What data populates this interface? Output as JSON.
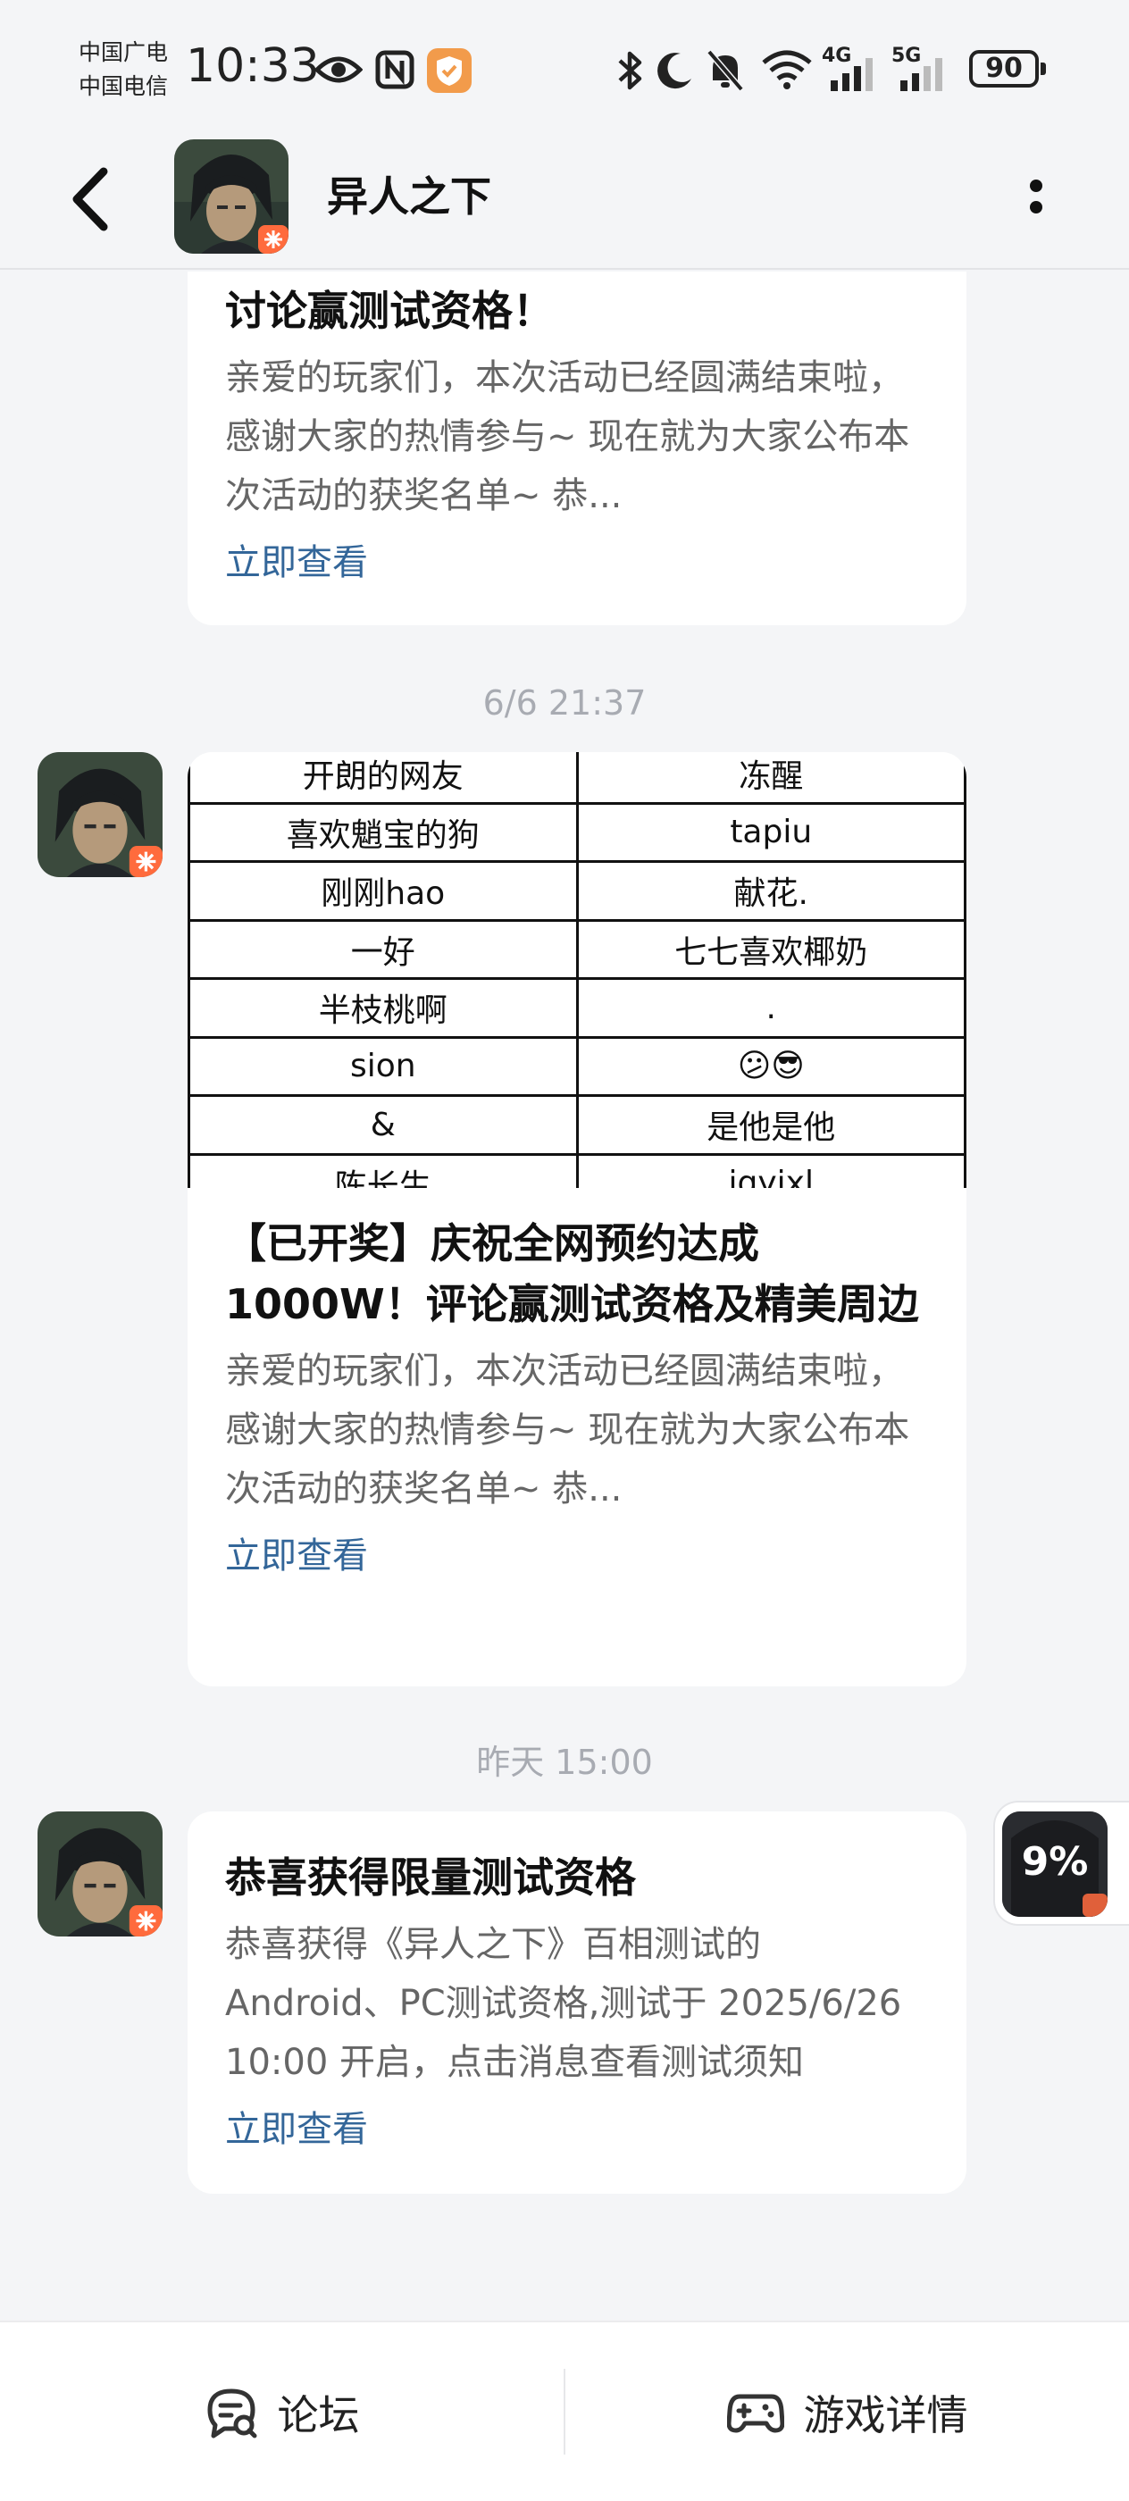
{
  "status_bar": {
    "carrier_1": "中国广电",
    "carrier_2": "中国电信",
    "time": "10:33",
    "network_1": "4G",
    "network_2": "5G",
    "battery": "90",
    "icons": [
      "eye-icon",
      "nfc-icon",
      "app-shield-icon",
      "bluetooth-icon",
      "moon-icon",
      "bell-muted-icon",
      "wifi-icon",
      "signal-icon",
      "signal-icon",
      "battery-icon"
    ]
  },
  "header": {
    "title": "异人之下"
  },
  "messages": [
    {
      "title": "讨论赢测试资格！",
      "body": "亲爱的玩家们，本次活动已经圆满结束啦，感谢大家的热情参与~ 现在就为大家公布本次活动的获奖名单~ 恭...",
      "link": "立即查看"
    },
    {
      "timestamp": "6/6  21:37",
      "table_rows": [
        [
          "开朗的网友",
          "冻醒"
        ],
        [
          "喜欢魈宝的狗",
          "tapiu"
        ],
        [
          "刚刚hao",
          "献花."
        ],
        [
          "一好",
          "七七喜欢椰奶"
        ],
        [
          "半枝桃啊",
          "."
        ],
        [
          "sion",
          "😕😎"
        ],
        [
          "&",
          "是他是他"
        ],
        [
          "陈长生",
          "jqyixl"
        ]
      ],
      "title": "【已开奖】庆祝全网预约达成1000W！评论赢测试资格及精美周边",
      "body": "亲爱的玩家们，本次活动已经圆满结束啦，感谢大家的热情参与~ 现在就为大家公布本次活动的获奖名单~ 恭...",
      "link": "立即查看"
    },
    {
      "timestamp": "昨天  15:00",
      "title": "恭喜获得限量测试资格",
      "body": "恭喜获得《异人之下》百相测试的Android、PC测试资格,测试于 2025/6/26 10:00 开启，点击消息查看测试须知",
      "link": "立即查看"
    }
  ],
  "float_badge": {
    "label": "9%"
  },
  "bottom_bar": {
    "forum": "论坛",
    "game_details": "游戏详情"
  },
  "colors": {
    "background": "#f4f5f7",
    "card": "#ffffff",
    "link": "#336699",
    "muted_text": "#666666",
    "timestamp": "#a8abb2"
  }
}
